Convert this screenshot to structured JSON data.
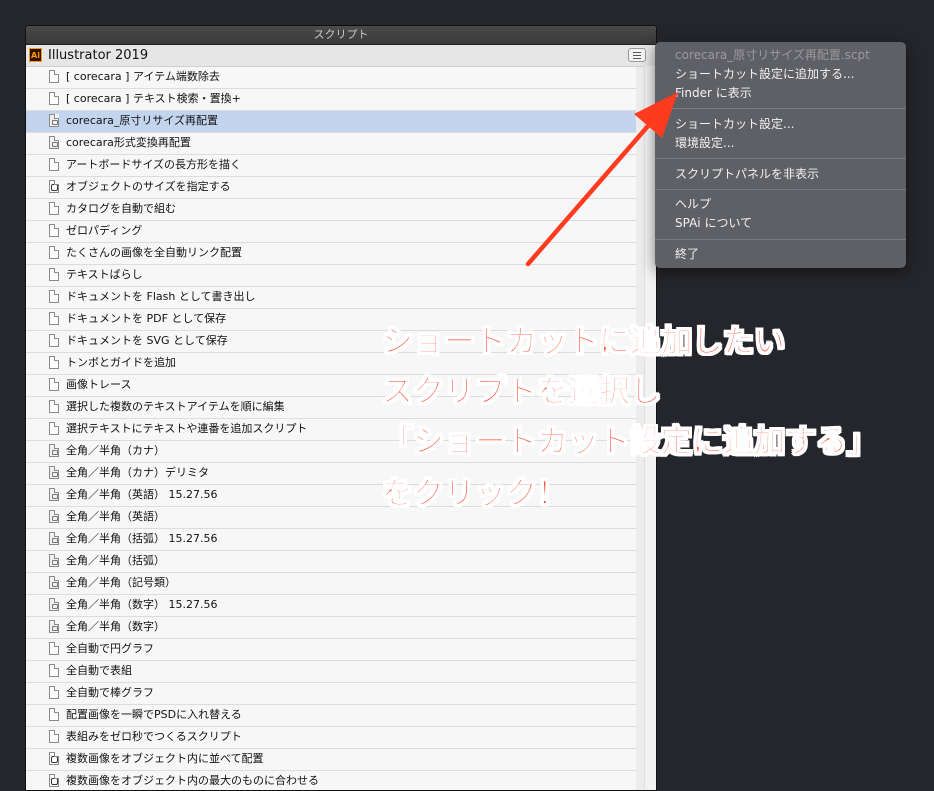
{
  "panel": {
    "title": "スクリプト",
    "group_title": "Illustrator 2019",
    "ai_badge": "Ai"
  },
  "scripts": [
    {
      "label": "[ corecara ] アイテム端数除去",
      "icon": "doc"
    },
    {
      "label": "[ corecara ] テキスト検索・置換+",
      "icon": "doc"
    },
    {
      "label": "corecara_原寸リサイズ再配置",
      "icon": "compiled",
      "selected": true
    },
    {
      "label": "corecara形式変換再配置",
      "icon": "compiled"
    },
    {
      "label": "アートボードサイズの長方形を描く",
      "icon": "doc"
    },
    {
      "label": "オブジェクトのサイズを指定する",
      "icon": "app"
    },
    {
      "label": "カタログを自動で組む",
      "icon": "doc"
    },
    {
      "label": "ゼロパディング",
      "icon": "doc"
    },
    {
      "label": "たくさんの画像を全自動リンク配置",
      "icon": "doc"
    },
    {
      "label": "テキストばらし",
      "icon": "doc"
    },
    {
      "label": "ドキュメントを Flash として書き出し",
      "icon": "doc"
    },
    {
      "label": "ドキュメントを PDF として保存",
      "icon": "doc"
    },
    {
      "label": "ドキュメントを SVG として保存",
      "icon": "doc"
    },
    {
      "label": "トンボとガイドを追加",
      "icon": "doc"
    },
    {
      "label": "画像トレース",
      "icon": "doc"
    },
    {
      "label": "選択した複数のテキストアイテムを順に編集",
      "icon": "doc"
    },
    {
      "label": "選択テキストにテキストや連番を追加スクリプト",
      "icon": "doc"
    },
    {
      "label": "全角／半角（カナ）",
      "icon": "compiled"
    },
    {
      "label": "全角／半角（カナ）デリミタ",
      "icon": "compiled"
    },
    {
      "label": "全角／半角（英語） 15.27.56",
      "icon": "compiled"
    },
    {
      "label": "全角／半角（英語）",
      "icon": "compiled"
    },
    {
      "label": "全角／半角（括弧） 15.27.56",
      "icon": "compiled"
    },
    {
      "label": "全角／半角（括弧）",
      "icon": "compiled"
    },
    {
      "label": "全角／半角（記号類）",
      "icon": "compiled"
    },
    {
      "label": "全角／半角（数字） 15.27.56",
      "icon": "compiled"
    },
    {
      "label": "全角／半角（数字）",
      "icon": "compiled"
    },
    {
      "label": "全自動で円グラフ",
      "icon": "doc"
    },
    {
      "label": "全自動で表組",
      "icon": "doc"
    },
    {
      "label": "全自動で棒グラフ",
      "icon": "doc"
    },
    {
      "label": "配置画像を一瞬でPSDに入れ替える",
      "icon": "doc"
    },
    {
      "label": "表組みをゼロ秒でつくるスクリプト",
      "icon": "doc"
    },
    {
      "label": "複数画像をオブジェクト内に並べて配置",
      "icon": "app"
    },
    {
      "label": "複数画像をオブジェクト内の最大のものに合わせる",
      "icon": "app"
    }
  ],
  "context_menu": {
    "file_name": "corecara_原寸リサイズ再配置.scpt",
    "add_shortcut": "ショートカット設定に追加する...",
    "show_in_finder": "Finder に表示",
    "shortcut_settings": "ショートカット設定...",
    "preferences": "環境設定...",
    "hide_panel": "スクリプトパネルを非表示",
    "help": "ヘルプ",
    "about": "SPAi について",
    "quit": "終了"
  },
  "annotation": {
    "line1": "ショートカットに追加したい",
    "line2": "スクリプトを選択し",
    "line3": "「ショートカット設定に追加する」",
    "line4": "をクリック！",
    "color": "#ff3b1f"
  }
}
